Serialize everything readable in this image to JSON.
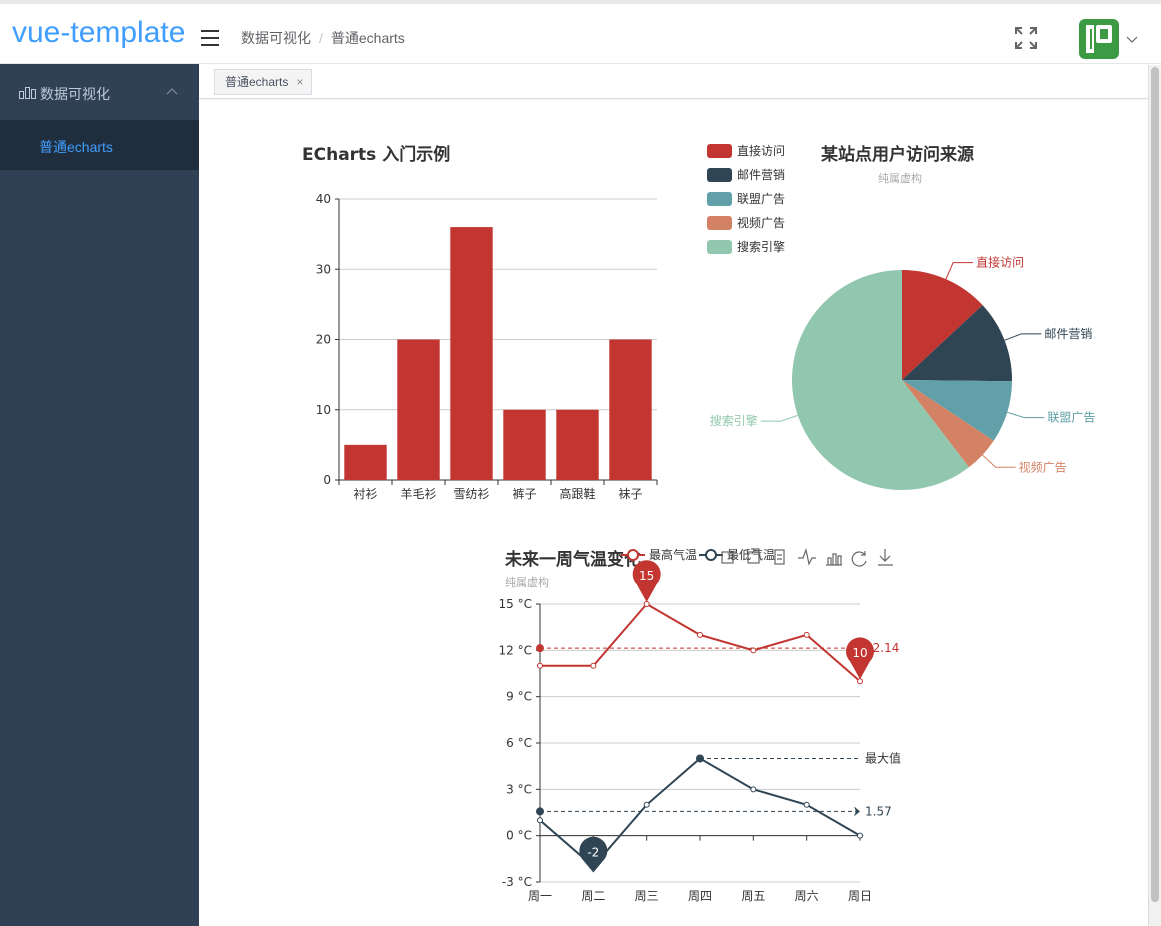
{
  "header": {
    "logo": "vue-template",
    "breadcrumb": [
      "数据可视化",
      "普通echarts"
    ],
    "breadcrumb_sep": "/"
  },
  "sidebar": {
    "group_label": "数据可视化",
    "items": [
      {
        "label": "普通echarts",
        "active": true
      }
    ]
  },
  "tags": [
    {
      "label": "普通echarts",
      "close": "×"
    }
  ],
  "colors": {
    "brand": "#409eff",
    "sidebar_bg": "#304156",
    "sidebar_sub_bg": "#1f2d3d",
    "red": "#c23531",
    "navy": "#2f4554",
    "teal": "#61a0a8",
    "orange": "#d48265",
    "green": "#91c7ae"
  },
  "chart_data": [
    {
      "type": "bar",
      "title": "ECharts 入门示例",
      "categories": [
        "衬衫",
        "羊毛衫",
        "雪纺衫",
        "裤子",
        "高跟鞋",
        "袜子"
      ],
      "values": [
        5,
        20,
        36,
        10,
        10,
        20
      ],
      "ylim": [
        0,
        40
      ],
      "yticks": [
        0,
        10,
        20,
        30,
        40
      ],
      "grid": true
    },
    {
      "type": "pie",
      "title": "某站点用户访问来源",
      "subtitle": "纯属虚构",
      "legend_position": "left",
      "slices": [
        {
          "name": "直接访问",
          "value": 335
        },
        {
          "name": "邮件营销",
          "value": 310
        },
        {
          "name": "联盟广告",
          "value": 234
        },
        {
          "name": "视频广告",
          "value": 135
        },
        {
          "name": "搜索引擎",
          "value": 1548
        }
      ]
    },
    {
      "type": "line",
      "title": "未来一周气温变化",
      "subtitle": "纯属虚构",
      "categories": [
        "周一",
        "周二",
        "周三",
        "周四",
        "周五",
        "周六",
        "周日"
      ],
      "ylim": [
        -3,
        15
      ],
      "yticks": [
        "-3 °C",
        "0 °C",
        "3 °C",
        "6 °C",
        "9 °C",
        "12 °C",
        "15 °C"
      ],
      "series": [
        {
          "name": "最高气温",
          "values": [
            11,
            11,
            15,
            13,
            12,
            13,
            10
          ],
          "mark_points": [
            {
              "index": 2,
              "value": "15"
            },
            {
              "index": 6,
              "value": "10"
            }
          ],
          "mark_line": {
            "value": 12.14,
            "label": "12.14"
          }
        },
        {
          "name": "最低气温",
          "values": [
            1,
            -2,
            2,
            5,
            3,
            2,
            0
          ],
          "mark_points": [
            {
              "index": 1,
              "value": "-2"
            }
          ],
          "mark_line_avg": {
            "value": 1.57,
            "label": "1.57"
          },
          "mark_line_max": {
            "value": 5,
            "label": "最大值"
          }
        }
      ],
      "grid": true,
      "toolbox": [
        "data-zoom-icon",
        "zoom-reset-icon",
        "data-view-icon",
        "line-chart-icon",
        "bar-chart-icon",
        "restore-icon",
        "save-image-icon"
      ]
    }
  ]
}
